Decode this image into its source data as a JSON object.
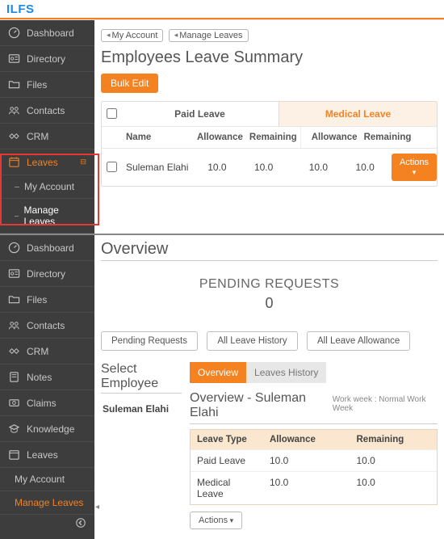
{
  "brand": "ILFS",
  "top": {
    "sidebar": {
      "items": [
        {
          "label": "Dashboard"
        },
        {
          "label": "Directory"
        },
        {
          "label": "Files"
        },
        {
          "label": "Contacts"
        },
        {
          "label": "CRM"
        },
        {
          "label": "Leaves"
        }
      ],
      "leaves_sub": [
        {
          "label": "My Account"
        },
        {
          "label": "Manage Leaves"
        }
      ]
    },
    "breadcrumbs": [
      "My Account",
      "Manage Leaves"
    ],
    "title": "Employees Leave Summary",
    "bulk_edit": "Bulk Edit",
    "groups": [
      "Paid Leave",
      "Medical Leave"
    ],
    "columns": [
      "Name",
      "Allowance",
      "Remaining",
      "Allowance",
      "Remaining"
    ],
    "rows": [
      {
        "name": "Suleman Elahi",
        "paid_allow": "10.0",
        "paid_rem": "10.0",
        "med_allow": "10.0",
        "med_rem": "10.0"
      }
    ],
    "actions_label": "Actions"
  },
  "bottom": {
    "sidebar": {
      "items": [
        {
          "label": "Dashboard"
        },
        {
          "label": "Directory"
        },
        {
          "label": "Files"
        },
        {
          "label": "Contacts"
        },
        {
          "label": "CRM"
        },
        {
          "label": "Notes"
        },
        {
          "label": "Claims"
        },
        {
          "label": "Knowledge"
        },
        {
          "label": "Leaves"
        }
      ],
      "leaves_sub": [
        {
          "label": "My Account"
        },
        {
          "label": "Manage Leaves"
        }
      ]
    },
    "overview_title": "Overview",
    "pending": {
      "label": "PENDING REQUESTS",
      "count": "0"
    },
    "pills": [
      "Pending Requests",
      "All Leave History",
      "All Leave Allowance"
    ],
    "select_employee_title": "Select Employee",
    "employee": "Suleman Elahi",
    "tabs": [
      {
        "label": "Overview",
        "active": true
      },
      {
        "label": "Leaves History",
        "active": false
      }
    ],
    "detail_title": "Overview - Suleman Elahi",
    "work_week": "Work week : Normal Work Week",
    "mini_cols": [
      "Leave Type",
      "Allowance",
      "Remaining"
    ],
    "mini_rows": [
      {
        "type": "Paid Leave",
        "allow": "10.0",
        "rem": "10.0"
      },
      {
        "type": "Medical Leave",
        "allow": "10.0",
        "rem": "10.0"
      }
    ],
    "actions_label": "Actions"
  }
}
